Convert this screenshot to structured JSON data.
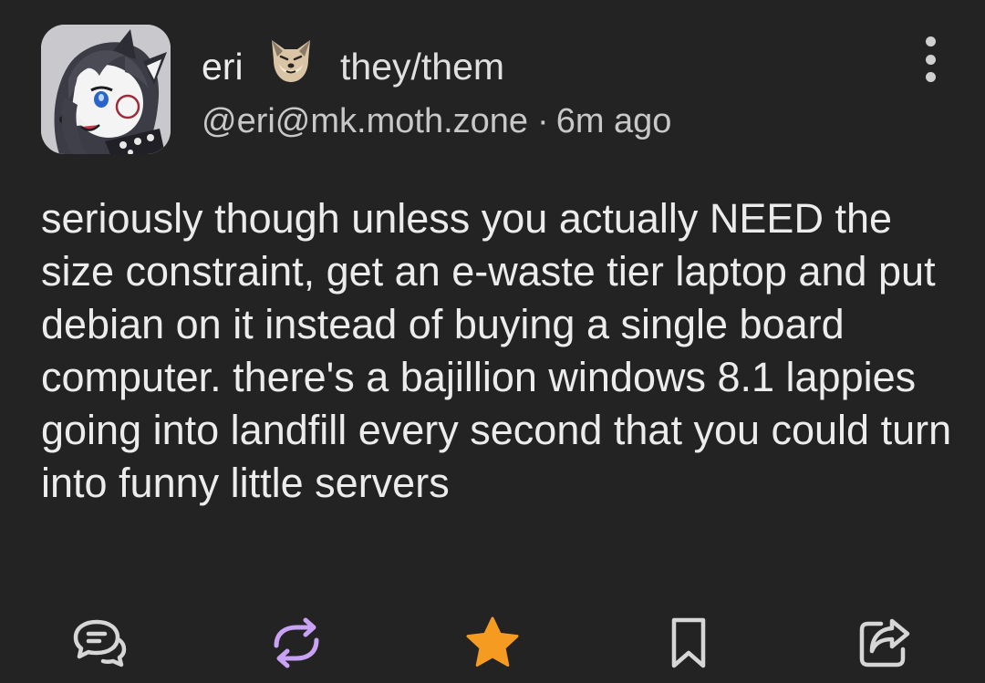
{
  "author": {
    "display_name": "eri",
    "name_emoji_icon": "wolf-face-emoji-icon",
    "pronouns": "they/them",
    "handle": "@eri@mk.moth.zone",
    "separator": "·",
    "time_ago": "6m ago",
    "avatar_icon": "anime-wolf-avatar"
  },
  "post": {
    "text": "seriously though unless you actually NEED the size constraint, get an e-waste tier laptop and put debian on it instead of buying a single board computer. there's a bajillion windows 8.1 lappies going into landfill every second that you could turn into funny little servers"
  },
  "actions": [
    {
      "icon": "reply-icon",
      "color": "#d6d6d6"
    },
    {
      "icon": "boost-icon",
      "color": "#c8a2f5",
      "active": true
    },
    {
      "icon": "favourite-star-icon",
      "color": "#f59b21",
      "active": true
    },
    {
      "icon": "bookmark-icon",
      "color": "#d6d6d6"
    },
    {
      "icon": "share-icon",
      "color": "#d6d6d6"
    }
  ],
  "colors": {
    "background": "#232323",
    "text": "#ececec",
    "muted_text": "#c8c8c8",
    "boost_accent": "#c8a2f5",
    "favourite_accent": "#f59b21"
  }
}
